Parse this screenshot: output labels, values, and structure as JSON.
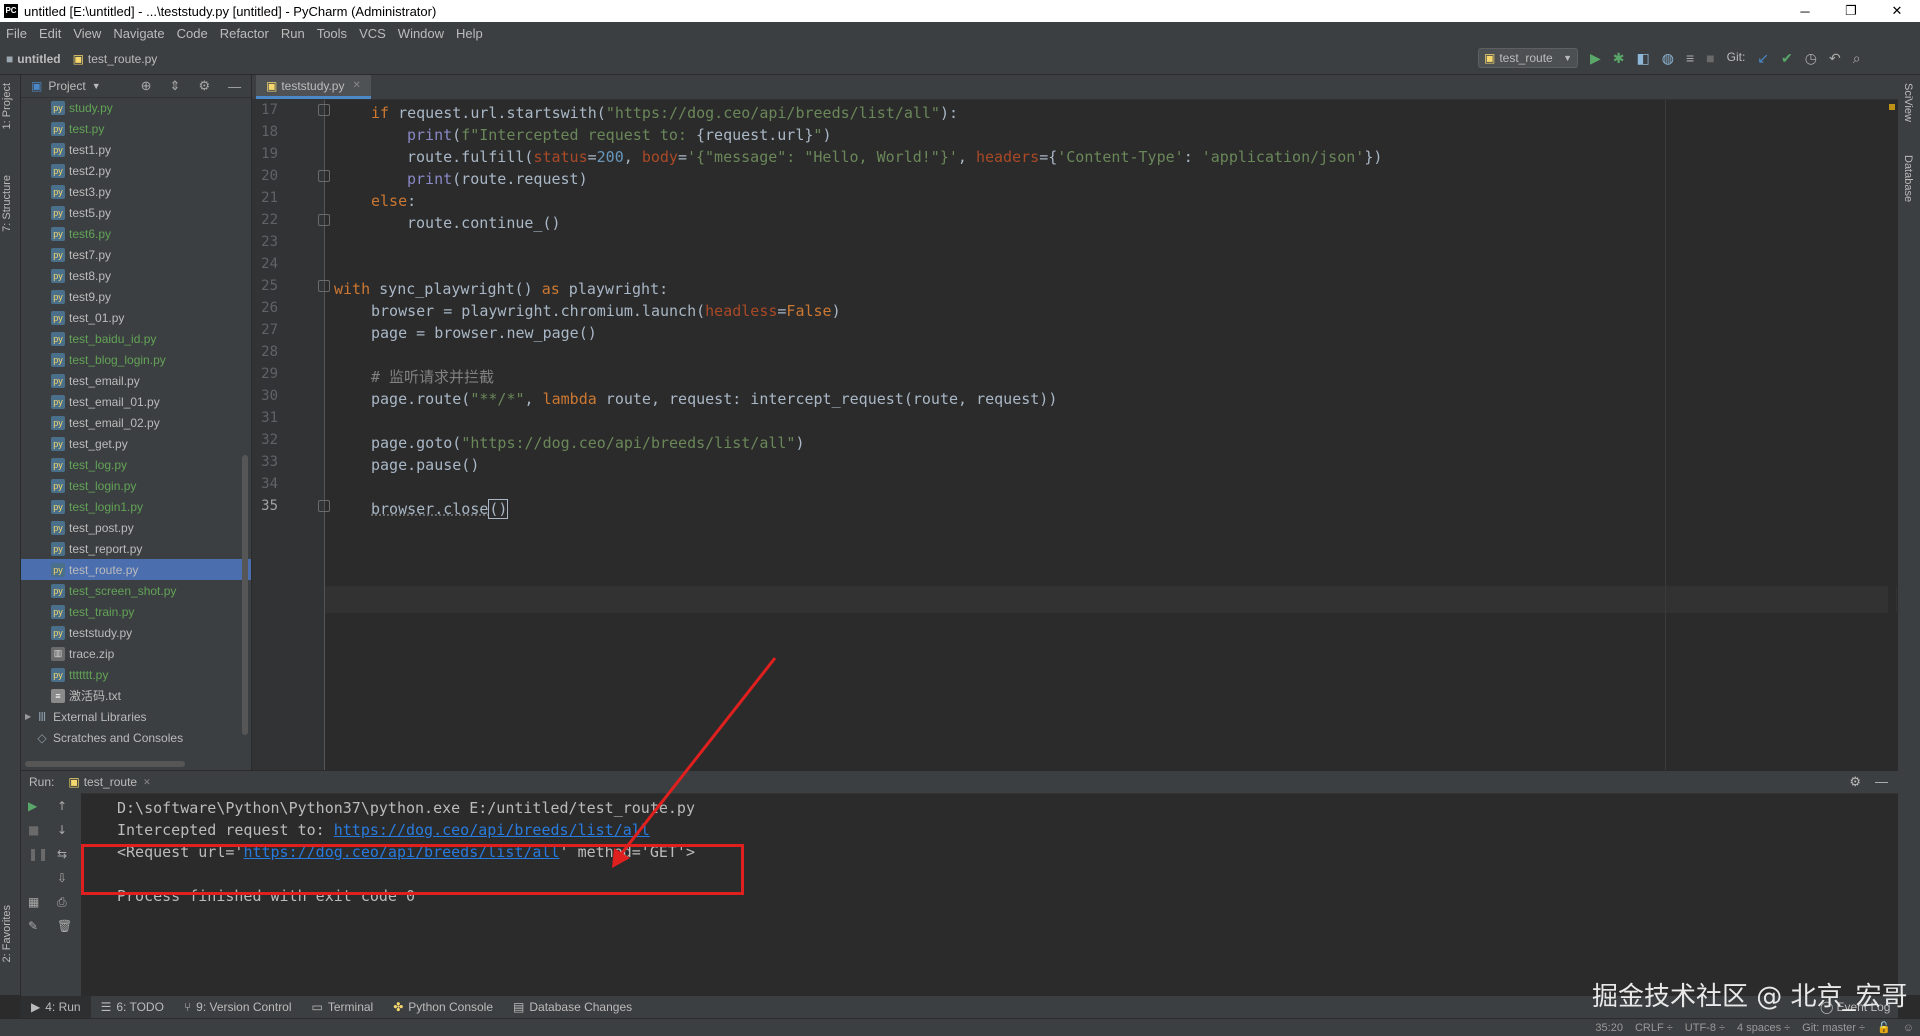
{
  "window": {
    "title": "untitled [E:\\untitled] - ...\\teststudy.py [untitled] - PyCharm (Administrator)",
    "logo_text": "PC",
    "minimize": "─",
    "maximize": "❐",
    "close": "✕"
  },
  "menu": [
    "File",
    "Edit",
    "View",
    "Navigate",
    "Code",
    "Refactor",
    "Run",
    "Tools",
    "VCS",
    "Window",
    "Help"
  ],
  "navbar": {
    "project": "untitled",
    "file": "test_route.py",
    "run_config": "test_route",
    "git_label": "Git:"
  },
  "left_strip": {
    "project_tab": "1: Project",
    "structure_tab": "7: Structure",
    "favorites_tab": "2: Favorites"
  },
  "right_strip": {
    "sciview_tab": "SciView",
    "database_tab": "Database"
  },
  "project_panel": {
    "title": "Project",
    "files": [
      {
        "name": "study.py",
        "vcs": "new"
      },
      {
        "name": "test.py",
        "vcs": "new"
      },
      {
        "name": "test1.py",
        "vcs": "none"
      },
      {
        "name": "test2.py",
        "vcs": "none"
      },
      {
        "name": "test3.py",
        "vcs": "none"
      },
      {
        "name": "test5.py",
        "vcs": "none"
      },
      {
        "name": "test6.py",
        "vcs": "new"
      },
      {
        "name": "test7.py",
        "vcs": "none"
      },
      {
        "name": "test8.py",
        "vcs": "none"
      },
      {
        "name": "test9.py",
        "vcs": "none"
      },
      {
        "name": "test_01.py",
        "vcs": "none"
      },
      {
        "name": "test_baidu_id.py",
        "vcs": "new"
      },
      {
        "name": "test_blog_login.py",
        "vcs": "new"
      },
      {
        "name": "test_email.py",
        "vcs": "none"
      },
      {
        "name": "test_email_01.py",
        "vcs": "none"
      },
      {
        "name": "test_email_02.py",
        "vcs": "none"
      },
      {
        "name": "test_get.py",
        "vcs": "none"
      },
      {
        "name": "test_log.py",
        "vcs": "new"
      },
      {
        "name": "test_login.py",
        "vcs": "new"
      },
      {
        "name": "test_login1.py",
        "vcs": "new"
      },
      {
        "name": "test_post.py",
        "vcs": "none"
      },
      {
        "name": "test_report.py",
        "vcs": "none"
      },
      {
        "name": "test_route.py",
        "vcs": "selected"
      },
      {
        "name": "test_screen_shot.py",
        "vcs": "new"
      },
      {
        "name": "test_train.py",
        "vcs": "new"
      },
      {
        "name": "teststudy.py",
        "vcs": "none"
      },
      {
        "name": "trace.zip",
        "vcs": "zip"
      },
      {
        "name": "ttttttt.py",
        "vcs": "new"
      },
      {
        "name": "激活码.txt",
        "vcs": "txt"
      }
    ],
    "external_libraries": "External Libraries",
    "scratches": "Scratches and Consoles"
  },
  "editor": {
    "tab": "teststudy.py",
    "line_numbers": [
      "17",
      "18",
      "19",
      "20",
      "21",
      "22",
      "23",
      "24",
      "25",
      "26",
      "27",
      "28",
      "29",
      "30",
      "31",
      "32",
      "33",
      "34",
      "35"
    ],
    "current_line": "35"
  },
  "run_panel": {
    "label": "Run:",
    "tab": "test_route",
    "cmd": "D:\\software\\Python\\Python37\\python.exe E:/untitled/test_route.py",
    "intercepted_prefix": "Intercepted request to: ",
    "intercepted_url": "https://dog.ceo/api/breeds/list/all",
    "request_prefix": "<Request url='",
    "request_url": "https://dog.ceo/api/breeds/list/all",
    "request_suffix": "' method='GET'>",
    "finished": "Process finished with exit code 0"
  },
  "bottom_tabs": [
    "4: Run",
    "6: TODO",
    "9: Version Control",
    "Terminal",
    "Python Console",
    "Database Changes"
  ],
  "event_log": "Event Log",
  "watermark": "掘金技术社区 @ 北京_宏哥",
  "status": {
    "position": "35:20",
    "line_sep": "CRLF ÷",
    "encoding": "UTF-8 ÷",
    "indent": "4 spaces ÷",
    "git": "Git: master ÷"
  },
  "colors": {
    "highlight_box": "#e0201e",
    "selection": "#4b6eaf",
    "link": "#287bde"
  }
}
